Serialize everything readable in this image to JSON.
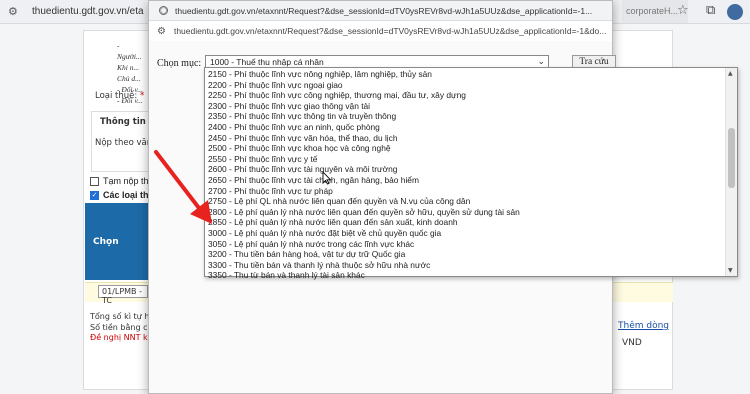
{
  "browser": {
    "url": "thuedientu.gdt.gov.vn/eta",
    "right_tab": "corporateH..."
  },
  "background": {
    "list_items": [
      "-",
      "Người...",
      "Khi n...",
      "Chủ d...",
      "- Đối v...",
      "- Đối v..."
    ],
    "loai_thue_label": "Loại thuế:",
    "required_mark": "*",
    "thong_tin_title": "Thông tin kh",
    "nop_theo": "Nộp theo văn b",
    "tam_nop": "Tạm nộp thu",
    "cac_loai": "Các loại thuế",
    "table_header": "Chọn",
    "code_value": "01/LPMB - TC",
    "tong_so": "Tổng số kì tự hiệ",
    "so_tien": "Số tiền bằng chữ",
    "de_nghi": "Đề nghị NNT kiể",
    "link_right": "Thêm dòng",
    "vnd": "VND"
  },
  "popup": {
    "title": "thuedientu.gdt.gov.vn/etaxnnt/Request?&dse_sessionId=dTV0ysREVr8vd-wJh1a5UUz&dse_applicationId=-1...",
    "url": "thuedientu.gdt.gov.vn/etaxnnt/Request?&dse_sessionId=dTV0ysREVr8vd-wJh1a5UUz&dse_applicationId=-1&do...",
    "chon_muc_label": "Chọn mục:",
    "selected_value": "1000 - Thuế thu nhập cá nhân",
    "tra_cuu_button": "Tra cứu"
  },
  "dropdown": {
    "items": [
      "2150 - Phí thuộc lĩnh vực nông nghiệp, lâm nghiệp, thủy sản",
      "2200 - Phí thuộc lĩnh vực ngoại giao",
      "2250 - Phí thuộc lĩnh vực công nghiệp, thương mại, đầu tư, xây dựng",
      "2300 - Phí thuộc lĩnh vực giao thông vận tải",
      "2350 - Phí thuộc lĩnh vực thông tin và truyền thông",
      "2400 - Phí thuộc lĩnh vực an ninh, quốc phòng",
      "2450 - Phí thuộc lĩnh vực văn hóa, thể thao, du lịch",
      "2500 - Phí thuộc lĩnh vực khoa học và công nghệ",
      "2550 - Phí thuộc lĩnh vực y tế",
      "2600 - Phí thuộc lĩnh vực tài nguyên và môi trường",
      "2650 - Phí thuộc lĩnh vực tài chính, ngân hàng, bảo hiểm",
      "2700 - Phí thuộc lĩnh vực tư pháp",
      "2750 - Lệ phí QL nhà nước liên quan đến quyền và N.vụ của công dân",
      "2800 - Lệ phí quản lý nhà nước liên quan đến quyền sở hữu, quyền sử dụng tài sản",
      "2850 - Lệ phí quản lý nhà nước liên quan đến sản xuất, kinh doanh",
      "3000 - Lệ phí quản lý nhà nước đặt biệt về chủ quyền quốc gia",
      "3050 - Lệ phí quản lý nhà nước trong các lĩnh vực khác",
      "3200 - Thu tiền bán hàng hoá, vật tư dự trữ Quốc gia",
      "3300 - Thu tiền bán và thanh lý nhà thuộc sở hữu nhà nước",
      "3350 - Thu từ bán và thanh lý tài sản khác"
    ]
  },
  "colors": {
    "arrow": "#e8231f",
    "header_blue": "#1d6aa8"
  }
}
